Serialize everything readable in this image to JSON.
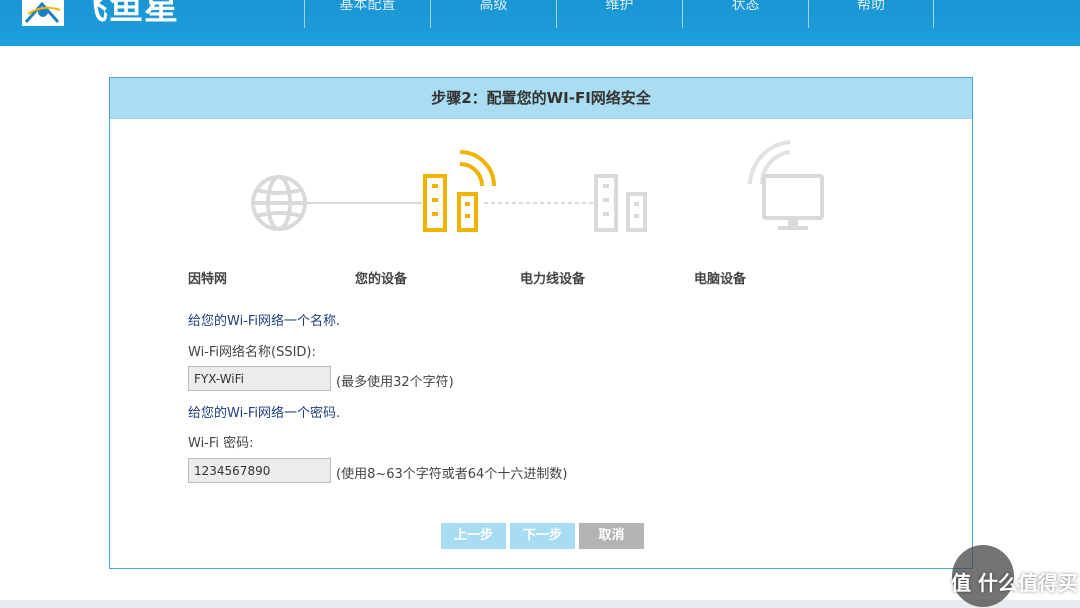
{
  "header": {
    "logo_text": "飞鱼星",
    "nav": [
      "基本配置",
      "高级",
      "维护",
      "状态",
      "帮助"
    ]
  },
  "wizard": {
    "title": "步骤2：配置您的WI-FI网络安全",
    "steps": [
      "因特网",
      "您的设备",
      "电力线设备",
      "电脑设备"
    ],
    "ssid_instruction": "给您的Wi-Fi网络一个名称.",
    "ssid_label": "Wi-Fi网络名称(SSID):",
    "ssid_value": "FYX-WiFi",
    "ssid_hint": "(最多使用32个字符)",
    "pwd_instruction": "给您的Wi-Fi网络一个密码.",
    "pwd_label": "Wi-Fi 密码:",
    "pwd_value": "1234567890",
    "pwd_hint": "(使用8~63个字符或者64个十六进制数)",
    "buttons": {
      "prev": "上一步",
      "next": "下一步",
      "cancel": "取消"
    }
  },
  "watermark": {
    "text": "值 什么值得买"
  },
  "colors": {
    "header_bg": "#1e9fdc",
    "panel_header_bg": "#aadcf2",
    "active_device": "#f0b400",
    "inactive_icon": "#d9d9d9",
    "instruction_text": "#1f3e7d"
  },
  "icons": [
    "globe-icon",
    "router-active-icon",
    "powerline-icon",
    "computer-icon"
  ]
}
